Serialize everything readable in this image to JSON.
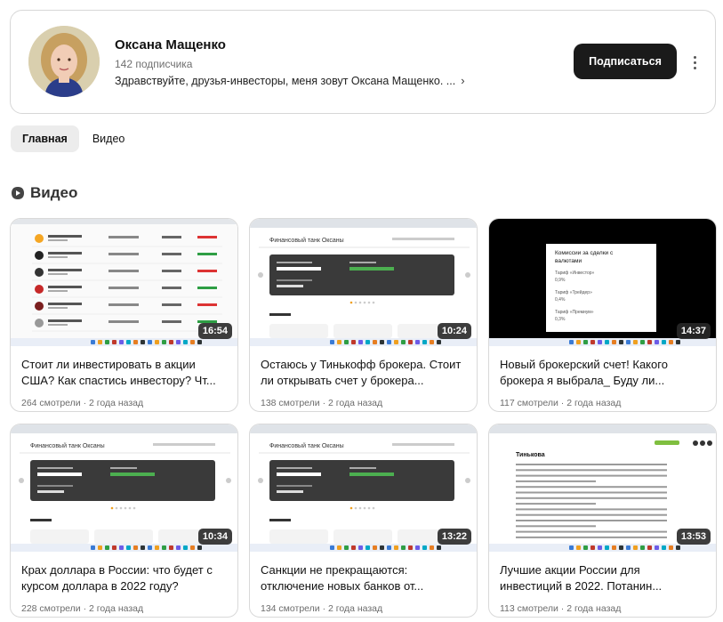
{
  "channel": {
    "name": "Оксана Мащенко",
    "subscribers": "142 подписчика",
    "description": "Здравствуйте, друзья-инвесторы, меня зовут Оксана Мащенко. ...",
    "subscribe_label": "Подписаться"
  },
  "tabs": [
    {
      "label": "Главная",
      "active": true
    },
    {
      "label": "Видео",
      "active": false
    }
  ],
  "section": {
    "title": "Видео",
    "icon": "video-play-icon"
  },
  "videos": [
    {
      "title": "Стоит ли инвестировать в акции США? Как спастись инвестору? Чт...",
      "meta": "264 смотрели · 2 года назад",
      "duration": "16:54",
      "thumb": "stock-list"
    },
    {
      "title": "Остаюсь у Тинькофф брокера. Стоит ли открывать счет у брокера...",
      "meta": "138 смотрели · 2 года назад",
      "duration": "10:24",
      "thumb": "finance-dashboard",
      "thumb_heading": "Финансовый танк Оксаны"
    },
    {
      "title": "Новый брокерский счет! Какого брокера я выбрала_ Буду ли...",
      "meta": "117 смотрели · 2 года назад",
      "duration": "14:37",
      "thumb": "slide",
      "slide_lines": [
        "Комиссии за сделки с",
        "валютами",
        "Тариф «Инвестор»",
        "0,9%",
        "Тариф «Трейдер»",
        "0,4%",
        "Тариф «Премиум»",
        "0,3%"
      ]
    },
    {
      "title": "Крах доллара в России: что будет с курсом доллара в 2022 году?",
      "meta": "228 смотрели · 2 года назад",
      "duration": "10:34",
      "thumb": "finance-dashboard",
      "thumb_heading": "Финансовый танк Оксаны"
    },
    {
      "title": "Санкции не прекращаются: отключение новых банков от...",
      "meta": "134 смотрели · 2 года назад",
      "duration": "13:22",
      "thumb": "finance-dashboard",
      "thumb_heading": "Финансовый танк Оксаны"
    },
    {
      "title": "Лучшие акции России для инвестиций в 2022. Потанин...",
      "meta": "113 смотрели · 2 года назад",
      "duration": "13:53",
      "thumb": "article",
      "thumb_heading": "Тинькова"
    }
  ],
  "colors": {
    "subscribe_bg": "#1a1a1a",
    "duration_bg": "#282828",
    "card_border": "#d9d9d9"
  }
}
